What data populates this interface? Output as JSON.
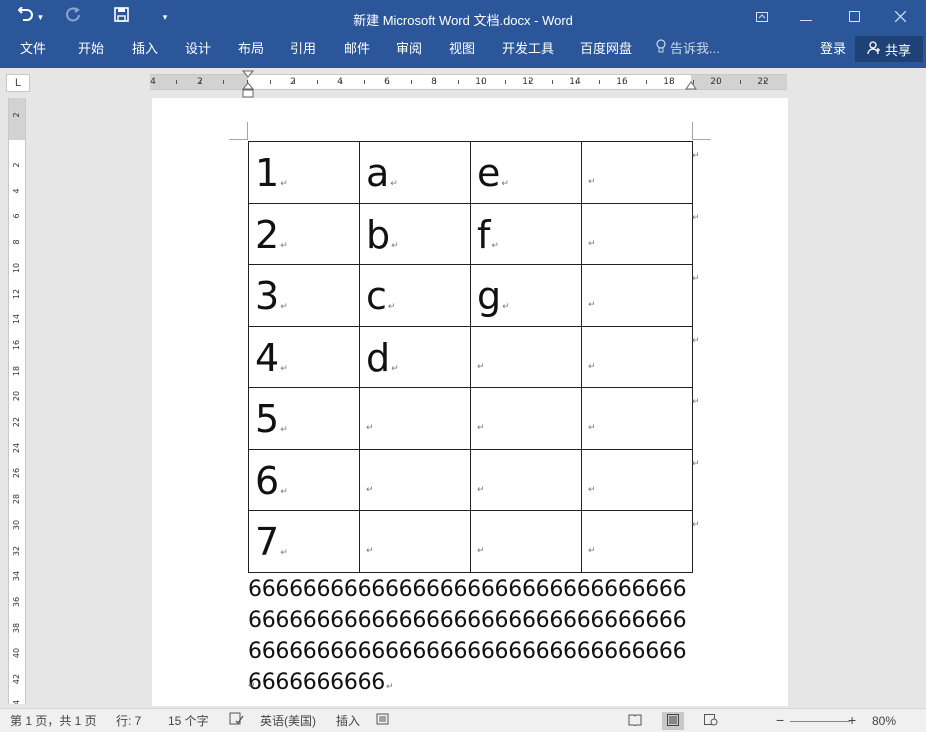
{
  "window": {
    "title": "新建 Microsoft Word 文档.docx - Word"
  },
  "quick_access": {
    "undo_icon": "undo-arrow",
    "redo_icon": "redo-arrow",
    "save_icon": "floppy-disk",
    "customize_icon": "dropdown-caret"
  },
  "ribbon": {
    "tabs": [
      "文件",
      "开始",
      "插入",
      "设计",
      "布局",
      "引用",
      "邮件",
      "审阅",
      "视图",
      "开发工具",
      "百度网盘"
    ],
    "tell_me": "告诉我...",
    "login": "登录",
    "share": "共享"
  },
  "ruler": {
    "corner": "L",
    "h_numbers": [
      "4",
      "2",
      "2",
      "4",
      "6",
      "8",
      "10",
      "12",
      "14",
      "16",
      "18",
      "20",
      "22"
    ],
    "v_numbers": [
      "2",
      "2",
      "4",
      "6",
      "8",
      "10",
      "12",
      "14",
      "16",
      "18",
      "20",
      "22",
      "24",
      "26",
      "28",
      "30",
      "32",
      "34",
      "36",
      "38",
      "40",
      "42",
      "44"
    ]
  },
  "document": {
    "table": [
      [
        "1",
        "a",
        "e",
        ""
      ],
      [
        "2",
        "b",
        "f",
        ""
      ],
      [
        "3",
        "c",
        "g",
        ""
      ],
      [
        "4",
        "d",
        "",
        ""
      ],
      [
        "5",
        "",
        "",
        ""
      ],
      [
        "6",
        "",
        "",
        ""
      ],
      [
        "7",
        "",
        "",
        ""
      ]
    ],
    "paragraph_mark": "↵",
    "body_text": "6666666666666666666666666666666666666666666666666666666666666666666666666666666666666666666666666666666666"
  },
  "statusbar": {
    "page": "第 1 页，共 1 页",
    "row": "行: 7",
    "words": "15 个字",
    "language": "英语(美国)",
    "mode": "插入",
    "zoom": "80%"
  },
  "colors": {
    "ribbon_blue": "#2b579a",
    "share_dark": "#1e4275",
    "canvas_gray": "#e6e6e6"
  }
}
